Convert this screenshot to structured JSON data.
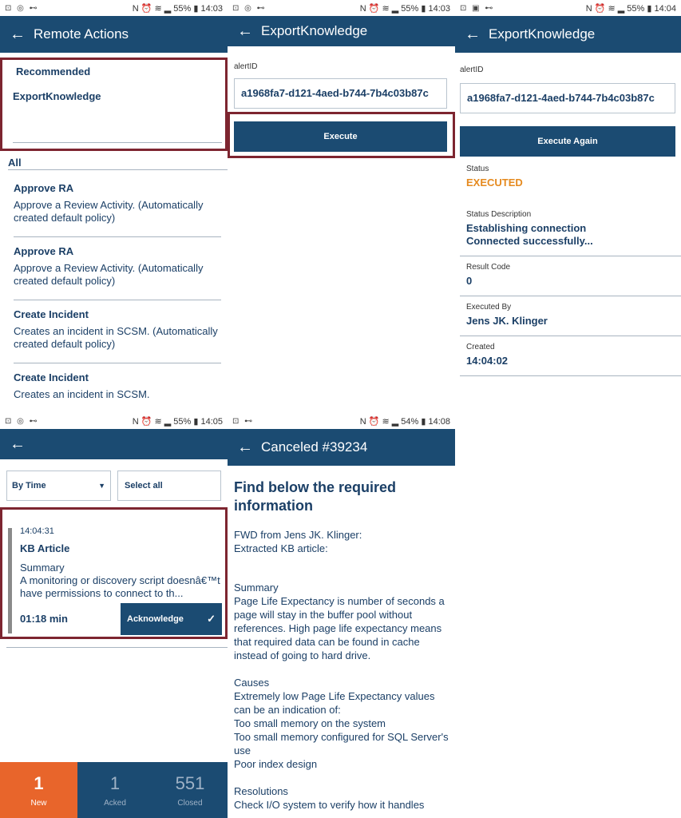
{
  "screen1": {
    "status": {
      "icons": "⊡ ◎ ⊷",
      "sys": "N ⏰ ≋ ▂",
      "battery": "55%",
      "time": "14:03"
    },
    "title": "Remote Actions",
    "recommended_label": "Recommended",
    "recommended_item": "ExportKnowledge",
    "all_label": "All",
    "items": [
      {
        "title": "Approve RA",
        "desc": "Approve a Review Activity. (Automatically created default policy)"
      },
      {
        "title": "Approve RA",
        "desc": "Approve a Review Activity. (Automatically created default policy)"
      },
      {
        "title": "Create Incident",
        "desc": "Creates an incident in SCSM. (Automatically created default policy)"
      },
      {
        "title": "Create Incident",
        "desc": "Creates an incident in SCSM."
      }
    ]
  },
  "screen2": {
    "status": {
      "icons": "⊡ ◎ ⊷",
      "sys": "N ⏰ ≋ ▂",
      "battery": "55%",
      "time": "14:03"
    },
    "title": "ExportKnowledge",
    "field_label": "alertID",
    "field_value": "a1968fa7-d121-4aed-b744-7b4c03b87c",
    "button": "Execute"
  },
  "screen3": {
    "status": {
      "icons": "⊡ ▣ ⊷",
      "sys": "N ⏰ ≋ ▂",
      "battery": "55%",
      "time": "14:04"
    },
    "title": "ExportKnowledge",
    "field_label": "alertID",
    "field_value": "a1968fa7-d121-4aed-b744-7b4c03b87c",
    "button": "Execute Again",
    "status_label": "Status",
    "status_value": "EXECUTED",
    "desc_label": "Status Description",
    "desc_line1": "Establishing connection",
    "desc_line2": "Connected successfully...",
    "result_label": "Result Code",
    "result_value": "0",
    "by_label": "Executed By",
    "by_value": "Jens JK. Klinger",
    "created_label": "Created",
    "created_value": "14:04:02"
  },
  "screen4": {
    "status": {
      "icons": "⊡ ◎ ⊷",
      "sys": "N ⏰ ≋ ▂",
      "battery": "55%",
      "time": "14:05"
    },
    "sort_value": "By Time",
    "select_all": "Select all",
    "card_time": "14:04:31",
    "card_title": "KB Article",
    "card_summary_label": "Summary",
    "card_summary": "A monitoring or discovery script doesnâ€™t have permissions to connect to th...",
    "card_duration": "01:18 min",
    "ack_button": "Acknowledge",
    "tabs": [
      {
        "count": "1",
        "label": "New"
      },
      {
        "count": "1",
        "label": "Acked"
      },
      {
        "count": "551",
        "label": "Closed"
      }
    ],
    "colors": {
      "new_tab": "#e8652b",
      "other_tabs": "#1b4b72"
    }
  },
  "screen5": {
    "status": {
      "icons": "⊡ ⊷",
      "sys": "N ⏰ ≋ ▂",
      "battery": "54%",
      "time": "14:08"
    },
    "title": "Canceled #39234",
    "heading": "Find below the required information",
    "intro1": "FWD from Jens JK. Klinger:",
    "intro2": "Extracted KB article:",
    "summary_label": "Summary",
    "summary_text": "Page Life Expectancy is number of seconds a page will stay in the buffer pool without references. High page life expectancy means that required data can be found in cache instead of going to hard drive.",
    "causes_label": "Causes",
    "causes_lines": [
      "Extremely low Page Life Expectancy values can be an indication of:",
      "Too small memory on the system",
      "Too small memory configured for SQL Server's use",
      "Poor index design"
    ],
    "resolutions_label": "Resolutions",
    "resolutions_text": "Check I/O system to verify how it handles"
  }
}
